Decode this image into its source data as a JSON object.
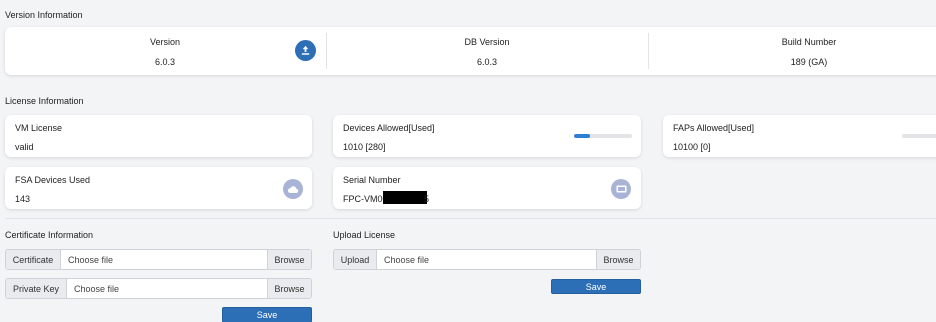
{
  "version_section": {
    "title": "Version Information",
    "version_label": "Version",
    "version_value": "6.0.3",
    "db_label": "DB Version",
    "db_value": "6.0.3",
    "build_label": "Build Number",
    "build_value": "189 (GA)",
    "upload_icon": "upload-icon"
  },
  "license_section": {
    "title": "License Information",
    "vm_label": "VM License",
    "vm_value": "valid",
    "devices_label": "Devices Allowed[Used]",
    "devices_value": "1010 [280]",
    "devices_progress_fraction": 0.28,
    "faps_label": "FAPs Allowed[Used]",
    "faps_value": "10100 [0]",
    "faps_progress_fraction": 0.0,
    "fsa_label": "FSA Devices Used",
    "fsa_value": "143",
    "fsa_icon": "cloud-icon",
    "serial_label": "Serial Number",
    "serial_prefix": "FPC-VM00",
    "serial_suffix": "5",
    "serial_icon": "device-icon"
  },
  "certificate_section": {
    "title": "Certificate Information",
    "certificate_addon": "Certificate",
    "certificate_placeholder": "Choose file",
    "private_key_addon": "Private Key",
    "private_key_placeholder": "Choose file",
    "browse_label": "Browse",
    "save_label": "Save"
  },
  "upload_section": {
    "title": "Upload License",
    "upload_addon": "Upload",
    "upload_placeholder": "Choose file",
    "browse_label": "Browse",
    "save_label": "Save"
  },
  "colors": {
    "accent": "#2d6fb7",
    "icon_bg": "#a9b3d6",
    "progress": "#2d7fd3"
  }
}
